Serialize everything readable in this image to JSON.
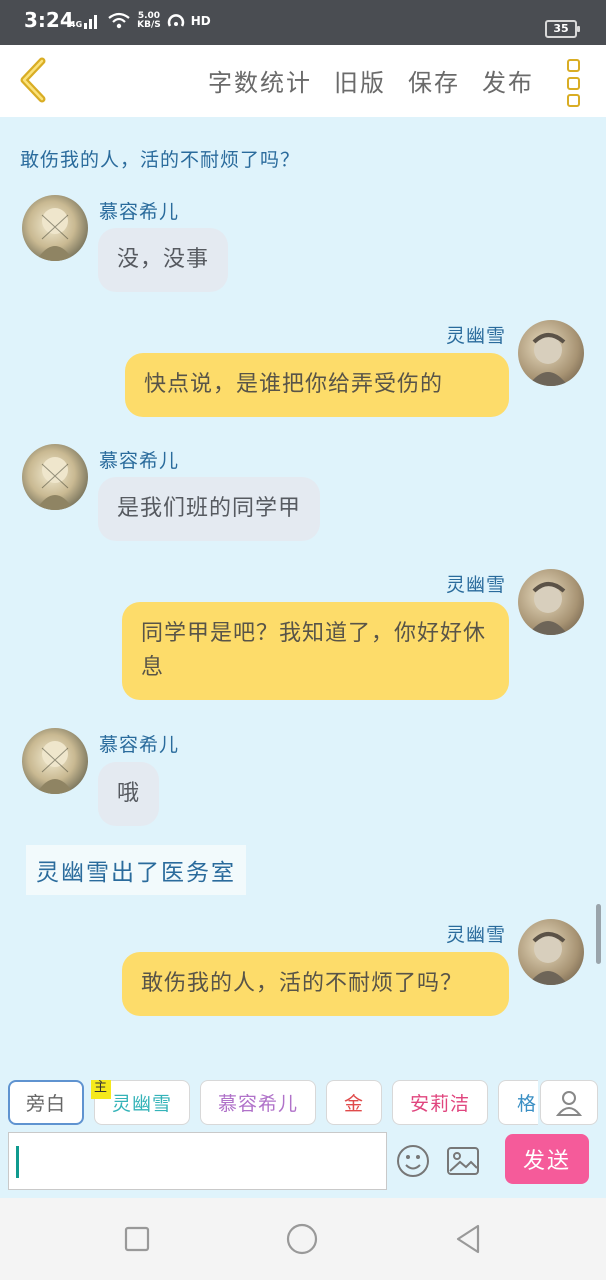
{
  "status_bar": {
    "time": "3:24",
    "network": "4G",
    "speed_top": "5.00",
    "speed_bottom": "KB/S",
    "hd": "HD",
    "battery": "35"
  },
  "header": {
    "actions": [
      "字数统计",
      "旧版",
      "保存",
      "发布"
    ]
  },
  "chat": {
    "top_line": "敢伤我的人，活的不耐烦了吗？",
    "messages": [
      {
        "side": "left",
        "name": "慕容希儿",
        "text": "没，没事"
      },
      {
        "side": "right",
        "name": "灵幽雪",
        "text": "快点说，是谁把你给弄受伤的"
      },
      {
        "side": "left",
        "name": "慕容希儿",
        "text": "是我们班的同学甲"
      },
      {
        "side": "right",
        "name": "灵幽雪",
        "text": "同学甲是吧？我知道了，你好好休息"
      },
      {
        "side": "left",
        "name": "慕容希儿",
        "text": "哦"
      },
      {
        "side": "right",
        "name": "灵幽雪",
        "text": "敢伤我的人，活的不耐烦了吗？"
      }
    ],
    "narration": "灵幽雪出了医务室"
  },
  "input_panel": {
    "roles": [
      {
        "label": "旁白",
        "color": "#666666"
      },
      {
        "label": "灵幽雪",
        "color": "#34b3b8",
        "badge": "主"
      },
      {
        "label": "慕容希儿",
        "color": "#b072c9"
      },
      {
        "label": "金",
        "color": "#e04b4b"
      },
      {
        "label": "安莉洁",
        "color": "#e0457e"
      },
      {
        "label": "格",
        "color": "#3a8fc4"
      }
    ],
    "input_value": "",
    "send_label": "发送"
  },
  "colors": {
    "accent_yellow": "#fddc6a",
    "left_bubble": "#e4eaf1",
    "send_pink": "#f55b9a",
    "name_blue": "#2a6b9c",
    "back_arrow": "#d9ad24"
  },
  "icons": {
    "back": "chevron-left-icon",
    "more": "more-vertical-icon",
    "contact": "person-icon",
    "emoji": "smiley-icon",
    "image": "image-icon",
    "nav_recent": "square-icon",
    "nav_home": "circle-icon",
    "nav_back": "triangle-back-icon"
  }
}
